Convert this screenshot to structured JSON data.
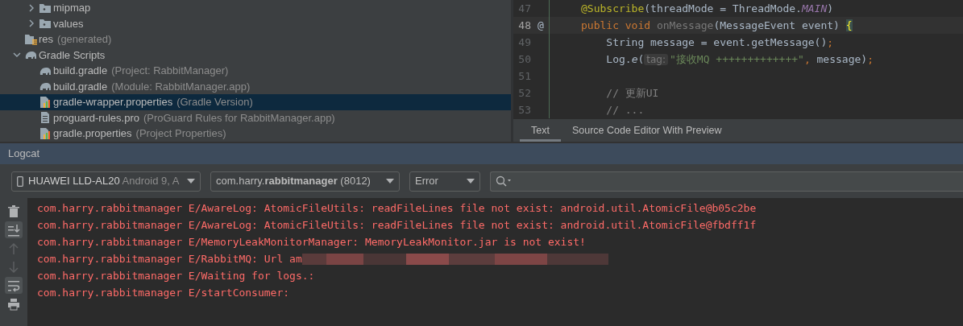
{
  "project_tree": {
    "items": [
      {
        "children": [
          {
            "label": "mipmap",
            "kind": "folder",
            "expanded": false,
            "selected": false
          },
          {
            "label": "values",
            "kind": "folder",
            "expanded": false,
            "selected": false
          }
        ]
      },
      {
        "label": "res",
        "note": "(generated)",
        "kind": "res-folder",
        "selected": false
      },
      {
        "label": "Gradle Scripts",
        "kind": "gradle",
        "expanded": true,
        "selected": false,
        "children": [
          {
            "label": "build.gradle",
            "note": "(Project: RabbitManager)",
            "kind": "gradle",
            "selected": false
          },
          {
            "label": "build.gradle",
            "note": "(Module: RabbitManager.app)",
            "kind": "gradle",
            "selected": false
          },
          {
            "label": "gradle-wrapper.properties",
            "note": "(Gradle Version)",
            "kind": "properties",
            "selected": true
          },
          {
            "label": "proguard-rules.pro",
            "note": "(ProGuard Rules for RabbitManager.app)",
            "kind": "file",
            "selected": false
          },
          {
            "label": "gradle.properties",
            "note": "(Project Properties)",
            "kind": "properties",
            "selected": false
          }
        ]
      }
    ]
  },
  "editor": {
    "lines": [
      {
        "number": "47",
        "current": false,
        "tokens": [
          {
            "kind": "annotation",
            "text": "@Subscribe"
          },
          {
            "kind": "plain",
            "text": "(threadMode = ThreadMode."
          },
          {
            "kind": "constant",
            "text": "MAIN"
          },
          {
            "kind": "plain",
            "text": ")"
          }
        ]
      },
      {
        "number": "48",
        "current": true,
        "gutter_mark": "@",
        "tokens": [
          {
            "kind": "keyword",
            "text": "public void "
          },
          {
            "kind": "unused",
            "text": "onMessage"
          },
          {
            "kind": "plain",
            "text": "(MessageEvent event) "
          },
          {
            "kind": "brace",
            "text": "{"
          }
        ]
      },
      {
        "number": "49",
        "current": false,
        "tokens": [
          {
            "kind": "plain",
            "text": "    String message = event.getMessage()"
          },
          {
            "kind": "keyword",
            "text": ";"
          }
        ]
      },
      {
        "number": "50",
        "current": false,
        "tokens": [
          {
            "kind": "plain",
            "text": "    Log."
          },
          {
            "kind": "static",
            "text": "e"
          },
          {
            "kind": "plain",
            "text": "("
          },
          {
            "kind": "hint",
            "text": "tag:"
          },
          {
            "kind": "string",
            "text": "\"接收MQ +++++++++++++\""
          },
          {
            "kind": "keyword",
            "text": ", "
          },
          {
            "kind": "plain",
            "text": "message)"
          },
          {
            "kind": "keyword",
            "text": ";"
          }
        ]
      },
      {
        "number": "51",
        "current": false
      },
      {
        "number": "52",
        "current": false,
        "tokens": [
          {
            "kind": "comment",
            "text": "    // 更新UI"
          }
        ]
      },
      {
        "number": "53",
        "current": false,
        "tokens": [
          {
            "kind": "comment",
            "text": "    // ..."
          }
        ]
      }
    ],
    "tabs": [
      {
        "label": "Text",
        "selected": true
      },
      {
        "label": "Source Code Editor With Preview",
        "selected": false
      }
    ]
  },
  "logcat": {
    "title": "Logcat",
    "device": "**HUAWEI LLD-AL20** Android 9, A",
    "process": "com.harry.**rabbitmanager** (8012)",
    "level": "Error",
    "tools": [
      {
        "kind": "trash",
        "on": false,
        "disabled": false
      },
      {
        "kind": "scroll-end",
        "on": true,
        "disabled": false
      },
      {
        "kind": "up",
        "on": false,
        "disabled": true
      },
      {
        "kind": "down",
        "on": false,
        "disabled": true
      },
      {
        "kind": "wrap",
        "on": true,
        "disabled": false
      },
      {
        "kind": "print",
        "on": false,
        "disabled": false
      }
    ],
    "lines": [
      {
        "text": "com.harry.rabbitmanager E/AwareLog: AtomicFileUtils: readFileLines file not exist: android.util.AtomicFile@b05c2be",
        "redacted": false
      },
      {
        "text": "com.harry.rabbitmanager E/AwareLog: AtomicFileUtils: readFileLines file not exist: android.util.AtomicFile@fbdff1f",
        "redacted": false
      },
      {
        "text": "com.harry.rabbitmanager E/MemoryLeakMonitorManager: MemoryLeakMonitor.jar is not exist!",
        "redacted": false
      },
      {
        "text": "com.harry.rabbitmanager E/RabbitMQ: Url am",
        "redacted": true
      },
      {
        "text": "com.harry.rabbitmanager E/Waiting for logs.:",
        "redacted": false
      },
      {
        "text": "com.harry.rabbitmanager E/startConsumer:",
        "redacted": false
      }
    ]
  }
}
